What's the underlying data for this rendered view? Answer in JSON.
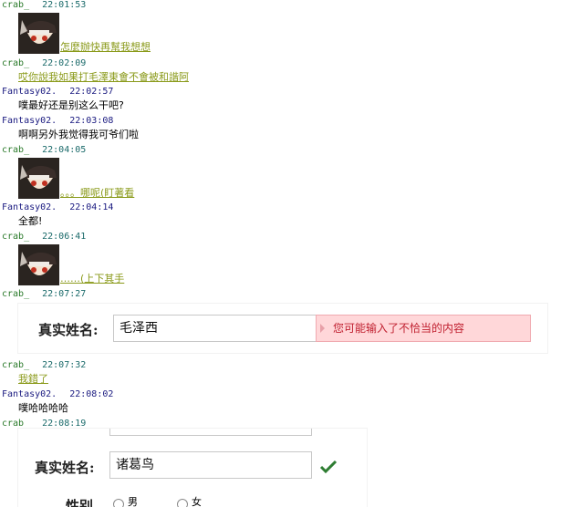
{
  "chat": {
    "m1": {
      "user": "crab_",
      "time": "22:01:53",
      "text": "怎麼辦快再幫我想想"
    },
    "m2": {
      "user": "crab_",
      "time": "22:02:09",
      "text": "哎你說我如果打毛澤東會不會被和諧阿"
    },
    "m3": {
      "user": "Fantasy02.",
      "time": "22:02:57",
      "text": "噗最好还是别这么干吧?"
    },
    "m4": {
      "user": "Fantasy02.",
      "time": "22:03:08",
      "text": "啊啊另外我觉得我可爷们啦"
    },
    "m5": {
      "user": "crab_",
      "time": "22:04:05",
      "text": "。。。哪呢(盯著看"
    },
    "m6": {
      "user": "Fantasy02.",
      "time": "22:04:14",
      "text": "全都!"
    },
    "m7": {
      "user": "crab_",
      "time": "22:06:41",
      "text": "……(上下其手"
    },
    "m8": {
      "user": "crab_",
      "time": "22:07:27"
    },
    "m9": {
      "user": "crab_",
      "time": "22:07:32",
      "text": "我錯了"
    },
    "m10": {
      "user": "Fantasy02.",
      "time": "22:08:02",
      "text": "噗哈哈哈哈"
    },
    "m11": {
      "user": "crab_",
      "time": "22:08:19"
    }
  },
  "form1": {
    "label": "真实姓名:",
    "value": "毛泽西",
    "error": "您可能输入了不恰当的内容"
  },
  "form2": {
    "label": "真实姓名:",
    "value": "诸葛鸟",
    "gender_label": "性别",
    "opt_male": "男",
    "opt_female": "女"
  },
  "colors": {
    "link": "#8a9a1a",
    "error_bg": "#ffd7d9",
    "error_text": "#c02030",
    "check": "#2e7d32"
  },
  "icons": [
    "avatar-icon",
    "error-arrow-icon",
    "checkmark-icon"
  ]
}
